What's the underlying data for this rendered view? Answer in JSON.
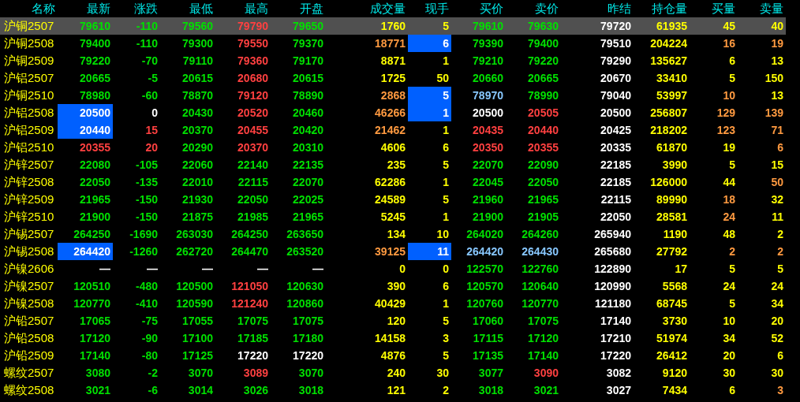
{
  "columns": [
    "名称",
    "最新",
    "涨跌",
    "最低",
    "最高",
    "开盘",
    "成交量",
    "现手",
    "买价",
    "卖价",
    "昨结",
    "持仓量",
    "买量",
    "卖量"
  ],
  "rows": [
    {
      "name": "沪铜2507",
      "selected": true,
      "latest_flash": false,
      "hand_flash": false,
      "cells": [
        {
          "text": "79610",
          "color": "#00e000"
        },
        {
          "text": "-110",
          "color": "#00e000"
        },
        {
          "text": "79560",
          "color": "#00e000"
        },
        {
          "text": "79790",
          "color": "#ff4040"
        },
        {
          "text": "79650",
          "color": "#00e000"
        },
        {
          "text": "1760",
          "color": "#ffff00"
        },
        {
          "text": "5",
          "color": "#ffff00"
        },
        {
          "text": "79610",
          "color": "#00e000"
        },
        {
          "text": "79630",
          "color": "#00e000"
        },
        {
          "text": "79720",
          "color": "#ffffff"
        },
        {
          "text": "61935",
          "color": "#ffff00"
        },
        {
          "text": "45",
          "color": "#ffff00"
        },
        {
          "text": "40",
          "color": "#ffff00"
        }
      ]
    },
    {
      "name": "沪铜2508",
      "selected": false,
      "latest_flash": false,
      "hand_flash": true,
      "cells": [
        {
          "text": "79400",
          "color": "#00e000"
        },
        {
          "text": "-110",
          "color": "#00e000"
        },
        {
          "text": "79300",
          "color": "#00e000"
        },
        {
          "text": "79550",
          "color": "#ff4040"
        },
        {
          "text": "79370",
          "color": "#00e000"
        },
        {
          "text": "18771",
          "color": "#ff9a40"
        },
        {
          "text": "6",
          "color": "#ffffff"
        },
        {
          "text": "79390",
          "color": "#00e000"
        },
        {
          "text": "79400",
          "color": "#00e000"
        },
        {
          "text": "79510",
          "color": "#ffffff"
        },
        {
          "text": "204224",
          "color": "#ffff00"
        },
        {
          "text": "16",
          "color": "#ff9a40"
        },
        {
          "text": "19",
          "color": "#ff9a40"
        }
      ]
    },
    {
      "name": "沪铜2509",
      "selected": false,
      "latest_flash": false,
      "hand_flash": false,
      "cells": [
        {
          "text": "79220",
          "color": "#00e000"
        },
        {
          "text": "-70",
          "color": "#00e000"
        },
        {
          "text": "79110",
          "color": "#00e000"
        },
        {
          "text": "79360",
          "color": "#ff4040"
        },
        {
          "text": "79170",
          "color": "#00e000"
        },
        {
          "text": "8871",
          "color": "#ffff00"
        },
        {
          "text": "1",
          "color": "#ffff00"
        },
        {
          "text": "79210",
          "color": "#00e000"
        },
        {
          "text": "79220",
          "color": "#00e000"
        },
        {
          "text": "79290",
          "color": "#ffffff"
        },
        {
          "text": "135627",
          "color": "#ffff00"
        },
        {
          "text": "6",
          "color": "#ffff00"
        },
        {
          "text": "13",
          "color": "#ffff00"
        }
      ]
    },
    {
      "name": "沪铝2507",
      "selected": false,
      "latest_flash": false,
      "hand_flash": false,
      "cells": [
        {
          "text": "20665",
          "color": "#00e000"
        },
        {
          "text": "-5",
          "color": "#00e000"
        },
        {
          "text": "20615",
          "color": "#00e000"
        },
        {
          "text": "20680",
          "color": "#ff4040"
        },
        {
          "text": "20615",
          "color": "#00e000"
        },
        {
          "text": "1725",
          "color": "#ffff00"
        },
        {
          "text": "50",
          "color": "#ffff00"
        },
        {
          "text": "20660",
          "color": "#00e000"
        },
        {
          "text": "20665",
          "color": "#00e000"
        },
        {
          "text": "20670",
          "color": "#ffffff"
        },
        {
          "text": "33410",
          "color": "#ffff00"
        },
        {
          "text": "5",
          "color": "#ffff00"
        },
        {
          "text": "150",
          "color": "#ffff00"
        }
      ]
    },
    {
      "name": "沪铜2510",
      "selected": false,
      "latest_flash": false,
      "hand_flash": true,
      "cells": [
        {
          "text": "78980",
          "color": "#00e000"
        },
        {
          "text": "-60",
          "color": "#00e000"
        },
        {
          "text": "78870",
          "color": "#00e000"
        },
        {
          "text": "79120",
          "color": "#ff4040"
        },
        {
          "text": "78890",
          "color": "#00e000"
        },
        {
          "text": "2868",
          "color": "#ff9a40"
        },
        {
          "text": "5",
          "color": "#ffffff"
        },
        {
          "text": "78970",
          "color": "#88c8ff"
        },
        {
          "text": "78990",
          "color": "#00e000"
        },
        {
          "text": "79040",
          "color": "#ffffff"
        },
        {
          "text": "53997",
          "color": "#ffff00"
        },
        {
          "text": "10",
          "color": "#ff9a40"
        },
        {
          "text": "13",
          "color": "#ffff00"
        }
      ]
    },
    {
      "name": "沪铝2508",
      "selected": false,
      "latest_flash": true,
      "hand_flash": true,
      "cells": [
        {
          "text": "20500",
          "color": "#ffffff"
        },
        {
          "text": "0",
          "color": "#ffffff"
        },
        {
          "text": "20430",
          "color": "#00e000"
        },
        {
          "text": "20520",
          "color": "#ff4040"
        },
        {
          "text": "20460",
          "color": "#00e000"
        },
        {
          "text": "46266",
          "color": "#ff9a40"
        },
        {
          "text": "1",
          "color": "#ffffff"
        },
        {
          "text": "20500",
          "color": "#ffffff"
        },
        {
          "text": "20505",
          "color": "#ff4040"
        },
        {
          "text": "20500",
          "color": "#ffffff"
        },
        {
          "text": "256807",
          "color": "#ffff00"
        },
        {
          "text": "129",
          "color": "#ff9a40"
        },
        {
          "text": "139",
          "color": "#ff9a40"
        }
      ]
    },
    {
      "name": "沪铝2509",
      "selected": false,
      "latest_flash": true,
      "hand_flash": false,
      "cells": [
        {
          "text": "20440",
          "color": "#ffffff"
        },
        {
          "text": "15",
          "color": "#ff4040"
        },
        {
          "text": "20370",
          "color": "#00e000"
        },
        {
          "text": "20455",
          "color": "#ff4040"
        },
        {
          "text": "20420",
          "color": "#00e000"
        },
        {
          "text": "21462",
          "color": "#ff9a40"
        },
        {
          "text": "1",
          "color": "#ffff00"
        },
        {
          "text": "20435",
          "color": "#ff4040"
        },
        {
          "text": "20440",
          "color": "#ff4040"
        },
        {
          "text": "20425",
          "color": "#ffffff"
        },
        {
          "text": "218202",
          "color": "#ffff00"
        },
        {
          "text": "123",
          "color": "#ff9a40"
        },
        {
          "text": "71",
          "color": "#ff9a40"
        }
      ]
    },
    {
      "name": "沪铝2510",
      "selected": false,
      "latest_flash": false,
      "hand_flash": false,
      "cells": [
        {
          "text": "20355",
          "color": "#ff4040"
        },
        {
          "text": "20",
          "color": "#ff4040"
        },
        {
          "text": "20290",
          "color": "#00e000"
        },
        {
          "text": "20370",
          "color": "#ff4040"
        },
        {
          "text": "20310",
          "color": "#00e000"
        },
        {
          "text": "4606",
          "color": "#ffff00"
        },
        {
          "text": "6",
          "color": "#ffff00"
        },
        {
          "text": "20350",
          "color": "#ff4040"
        },
        {
          "text": "20355",
          "color": "#ff4040"
        },
        {
          "text": "20335",
          "color": "#ffffff"
        },
        {
          "text": "61870",
          "color": "#ffff00"
        },
        {
          "text": "19",
          "color": "#ffff00"
        },
        {
          "text": "6",
          "color": "#ff9a40"
        }
      ]
    },
    {
      "name": "沪锌2507",
      "selected": false,
      "latest_flash": false,
      "hand_flash": false,
      "cells": [
        {
          "text": "22080",
          "color": "#00e000"
        },
        {
          "text": "-105",
          "color": "#00e000"
        },
        {
          "text": "22060",
          "color": "#00e000"
        },
        {
          "text": "22140",
          "color": "#00e000"
        },
        {
          "text": "22135",
          "color": "#00e000"
        },
        {
          "text": "235",
          "color": "#ffff00"
        },
        {
          "text": "5",
          "color": "#ffff00"
        },
        {
          "text": "22070",
          "color": "#00e000"
        },
        {
          "text": "22090",
          "color": "#00e000"
        },
        {
          "text": "22185",
          "color": "#ffffff"
        },
        {
          "text": "3990",
          "color": "#ffff00"
        },
        {
          "text": "5",
          "color": "#ffff00"
        },
        {
          "text": "15",
          "color": "#ffff00"
        }
      ]
    },
    {
      "name": "沪锌2508",
      "selected": false,
      "latest_flash": false,
      "hand_flash": false,
      "cells": [
        {
          "text": "22050",
          "color": "#00e000"
        },
        {
          "text": "-135",
          "color": "#00e000"
        },
        {
          "text": "22010",
          "color": "#00e000"
        },
        {
          "text": "22115",
          "color": "#00e000"
        },
        {
          "text": "22070",
          "color": "#00e000"
        },
        {
          "text": "62286",
          "color": "#ffff00"
        },
        {
          "text": "1",
          "color": "#ffff00"
        },
        {
          "text": "22045",
          "color": "#00e000"
        },
        {
          "text": "22050",
          "color": "#00e000"
        },
        {
          "text": "22185",
          "color": "#ffffff"
        },
        {
          "text": "126000",
          "color": "#ffff00"
        },
        {
          "text": "44",
          "color": "#ffff00"
        },
        {
          "text": "50",
          "color": "#ff9a40"
        }
      ]
    },
    {
      "name": "沪锌2509",
      "selected": false,
      "latest_flash": false,
      "hand_flash": false,
      "cells": [
        {
          "text": "21965",
          "color": "#00e000"
        },
        {
          "text": "-150",
          "color": "#00e000"
        },
        {
          "text": "21930",
          "color": "#00e000"
        },
        {
          "text": "22050",
          "color": "#00e000"
        },
        {
          "text": "22025",
          "color": "#00e000"
        },
        {
          "text": "24589",
          "color": "#ffff00"
        },
        {
          "text": "5",
          "color": "#ffff00"
        },
        {
          "text": "21960",
          "color": "#00e000"
        },
        {
          "text": "21965",
          "color": "#00e000"
        },
        {
          "text": "22115",
          "color": "#ffffff"
        },
        {
          "text": "89990",
          "color": "#ffff00"
        },
        {
          "text": "18",
          "color": "#ff9a40"
        },
        {
          "text": "32",
          "color": "#ffff00"
        }
      ]
    },
    {
      "name": "沪锌2510",
      "selected": false,
      "latest_flash": false,
      "hand_flash": false,
      "cells": [
        {
          "text": "21900",
          "color": "#00e000"
        },
        {
          "text": "-150",
          "color": "#00e000"
        },
        {
          "text": "21875",
          "color": "#00e000"
        },
        {
          "text": "21985",
          "color": "#00e000"
        },
        {
          "text": "21965",
          "color": "#00e000"
        },
        {
          "text": "5245",
          "color": "#ffff00"
        },
        {
          "text": "1",
          "color": "#ffff00"
        },
        {
          "text": "21900",
          "color": "#00e000"
        },
        {
          "text": "21905",
          "color": "#00e000"
        },
        {
          "text": "22050",
          "color": "#ffffff"
        },
        {
          "text": "28581",
          "color": "#ffff00"
        },
        {
          "text": "24",
          "color": "#ff9a40"
        },
        {
          "text": "11",
          "color": "#ffff00"
        }
      ]
    },
    {
      "name": "沪锡2507",
      "selected": false,
      "latest_flash": false,
      "hand_flash": false,
      "cells": [
        {
          "text": "264250",
          "color": "#00e000"
        },
        {
          "text": "-1690",
          "color": "#00e000"
        },
        {
          "text": "263030",
          "color": "#00e000"
        },
        {
          "text": "264250",
          "color": "#00e000"
        },
        {
          "text": "263650",
          "color": "#00e000"
        },
        {
          "text": "134",
          "color": "#ffff00"
        },
        {
          "text": "10",
          "color": "#ffff00"
        },
        {
          "text": "264020",
          "color": "#00e000"
        },
        {
          "text": "264260",
          "color": "#00e000"
        },
        {
          "text": "265940",
          "color": "#ffffff"
        },
        {
          "text": "1190",
          "color": "#ffff00"
        },
        {
          "text": "48",
          "color": "#ffff00"
        },
        {
          "text": "2",
          "color": "#ffff00"
        }
      ]
    },
    {
      "name": "沪锡2508",
      "selected": false,
      "latest_flash": true,
      "hand_flash": true,
      "cells": [
        {
          "text": "264420",
          "color": "#ffffff"
        },
        {
          "text": "-1260",
          "color": "#00e000"
        },
        {
          "text": "262720",
          "color": "#00e000"
        },
        {
          "text": "264470",
          "color": "#00e000"
        },
        {
          "text": "263520",
          "color": "#00e000"
        },
        {
          "text": "39125",
          "color": "#ff9a40"
        },
        {
          "text": "11",
          "color": "#ffffff"
        },
        {
          "text": "264420",
          "color": "#88c8ff"
        },
        {
          "text": "264430",
          "color": "#88c8ff"
        },
        {
          "text": "265680",
          "color": "#ffffff"
        },
        {
          "text": "27792",
          "color": "#ffff00"
        },
        {
          "text": "2",
          "color": "#ff9a40"
        },
        {
          "text": "2",
          "color": "#ff9a40"
        }
      ]
    },
    {
      "name": "沪镍2606",
      "selected": false,
      "latest_flash": false,
      "hand_flash": false,
      "cells": [
        {
          "text": "—",
          "color": "#ffffff"
        },
        {
          "text": "—",
          "color": "#ffffff"
        },
        {
          "text": "—",
          "color": "#ffffff"
        },
        {
          "text": "—",
          "color": "#ffffff"
        },
        {
          "text": "—",
          "color": "#ffffff"
        },
        {
          "text": "0",
          "color": "#ffff00"
        },
        {
          "text": "0",
          "color": "#ffff00"
        },
        {
          "text": "122570",
          "color": "#00e000"
        },
        {
          "text": "122760",
          "color": "#00e000"
        },
        {
          "text": "122890",
          "color": "#ffffff"
        },
        {
          "text": "17",
          "color": "#ffff00"
        },
        {
          "text": "5",
          "color": "#ffff00"
        },
        {
          "text": "5",
          "color": "#ffff00"
        }
      ]
    },
    {
      "name": "沪镍2507",
      "selected": false,
      "latest_flash": false,
      "hand_flash": false,
      "cells": [
        {
          "text": "120510",
          "color": "#00e000"
        },
        {
          "text": "-480",
          "color": "#00e000"
        },
        {
          "text": "120500",
          "color": "#00e000"
        },
        {
          "text": "121050",
          "color": "#ff4040"
        },
        {
          "text": "120630",
          "color": "#00e000"
        },
        {
          "text": "390",
          "color": "#ffff00"
        },
        {
          "text": "6",
          "color": "#ffff00"
        },
        {
          "text": "120570",
          "color": "#00e000"
        },
        {
          "text": "120640",
          "color": "#00e000"
        },
        {
          "text": "120990",
          "color": "#ffffff"
        },
        {
          "text": "5568",
          "color": "#ffff00"
        },
        {
          "text": "24",
          "color": "#ffff00"
        },
        {
          "text": "24",
          "color": "#ffff00"
        }
      ]
    },
    {
      "name": "沪镍2508",
      "selected": false,
      "latest_flash": false,
      "hand_flash": false,
      "cells": [
        {
          "text": "120770",
          "color": "#00e000"
        },
        {
          "text": "-410",
          "color": "#00e000"
        },
        {
          "text": "120590",
          "color": "#00e000"
        },
        {
          "text": "121240",
          "color": "#ff4040"
        },
        {
          "text": "120860",
          "color": "#00e000"
        },
        {
          "text": "40429",
          "color": "#ffff00"
        },
        {
          "text": "1",
          "color": "#ffff00"
        },
        {
          "text": "120760",
          "color": "#00e000"
        },
        {
          "text": "120770",
          "color": "#00e000"
        },
        {
          "text": "121180",
          "color": "#ffffff"
        },
        {
          "text": "68745",
          "color": "#ffff00"
        },
        {
          "text": "5",
          "color": "#ffff00"
        },
        {
          "text": "34",
          "color": "#ffff00"
        }
      ]
    },
    {
      "name": "沪铅2507",
      "selected": false,
      "latest_flash": false,
      "hand_flash": false,
      "cells": [
        {
          "text": "17065",
          "color": "#00e000"
        },
        {
          "text": "-75",
          "color": "#00e000"
        },
        {
          "text": "17055",
          "color": "#00e000"
        },
        {
          "text": "17075",
          "color": "#00e000"
        },
        {
          "text": "17075",
          "color": "#00e000"
        },
        {
          "text": "120",
          "color": "#ffff00"
        },
        {
          "text": "5",
          "color": "#ffff00"
        },
        {
          "text": "17060",
          "color": "#00e000"
        },
        {
          "text": "17075",
          "color": "#00e000"
        },
        {
          "text": "17140",
          "color": "#ffffff"
        },
        {
          "text": "3730",
          "color": "#ffff00"
        },
        {
          "text": "10",
          "color": "#ffff00"
        },
        {
          "text": "20",
          "color": "#ffff00"
        }
      ]
    },
    {
      "name": "沪铅2508",
      "selected": false,
      "latest_flash": false,
      "hand_flash": false,
      "cells": [
        {
          "text": "17120",
          "color": "#00e000"
        },
        {
          "text": "-90",
          "color": "#00e000"
        },
        {
          "text": "17100",
          "color": "#00e000"
        },
        {
          "text": "17185",
          "color": "#00e000"
        },
        {
          "text": "17180",
          "color": "#00e000"
        },
        {
          "text": "14158",
          "color": "#ffff00"
        },
        {
          "text": "3",
          "color": "#ffff00"
        },
        {
          "text": "17115",
          "color": "#00e000"
        },
        {
          "text": "17120",
          "color": "#00e000"
        },
        {
          "text": "17210",
          "color": "#ffffff"
        },
        {
          "text": "51974",
          "color": "#ffff00"
        },
        {
          "text": "34",
          "color": "#ffff00"
        },
        {
          "text": "52",
          "color": "#ffff00"
        }
      ]
    },
    {
      "name": "沪铅2509",
      "selected": false,
      "latest_flash": false,
      "hand_flash": false,
      "cells": [
        {
          "text": "17140",
          "color": "#00e000"
        },
        {
          "text": "-80",
          "color": "#00e000"
        },
        {
          "text": "17125",
          "color": "#00e000"
        },
        {
          "text": "17220",
          "color": "#ffffff"
        },
        {
          "text": "17220",
          "color": "#ffffff"
        },
        {
          "text": "4876",
          "color": "#ffff00"
        },
        {
          "text": "5",
          "color": "#ffff00"
        },
        {
          "text": "17135",
          "color": "#00e000"
        },
        {
          "text": "17140",
          "color": "#00e000"
        },
        {
          "text": "17220",
          "color": "#ffffff"
        },
        {
          "text": "26412",
          "color": "#ffff00"
        },
        {
          "text": "20",
          "color": "#ffff00"
        },
        {
          "text": "6",
          "color": "#ffff00"
        }
      ]
    },
    {
      "name": "螺纹2507",
      "selected": false,
      "latest_flash": false,
      "hand_flash": false,
      "cells": [
        {
          "text": "3080",
          "color": "#00e000"
        },
        {
          "text": "-2",
          "color": "#00e000"
        },
        {
          "text": "3070",
          "color": "#00e000"
        },
        {
          "text": "3089",
          "color": "#ff4040"
        },
        {
          "text": "3070",
          "color": "#00e000"
        },
        {
          "text": "240",
          "color": "#ffff00"
        },
        {
          "text": "30",
          "color": "#ffff00"
        },
        {
          "text": "3077",
          "color": "#00e000"
        },
        {
          "text": "3090",
          "color": "#ff4040"
        },
        {
          "text": "3082",
          "color": "#ffffff"
        },
        {
          "text": "9120",
          "color": "#ffff00"
        },
        {
          "text": "30",
          "color": "#ffff00"
        },
        {
          "text": "30",
          "color": "#ffff00"
        }
      ]
    },
    {
      "name": "螺纹2508",
      "selected": false,
      "latest_flash": false,
      "hand_flash": false,
      "cells": [
        {
          "text": "3021",
          "color": "#00e000"
        },
        {
          "text": "-6",
          "color": "#00e000"
        },
        {
          "text": "3014",
          "color": "#00e000"
        },
        {
          "text": "3026",
          "color": "#00e000"
        },
        {
          "text": "3018",
          "color": "#00e000"
        },
        {
          "text": "121",
          "color": "#ffff00"
        },
        {
          "text": "2",
          "color": "#ffff00"
        },
        {
          "text": "3018",
          "color": "#00e000"
        },
        {
          "text": "3021",
          "color": "#00e000"
        },
        {
          "text": "3027",
          "color": "#ffffff"
        },
        {
          "text": "7434",
          "color": "#ffff00"
        },
        {
          "text": "6",
          "color": "#ffff00"
        },
        {
          "text": "3",
          "color": "#ff9a40"
        }
      ]
    }
  ]
}
